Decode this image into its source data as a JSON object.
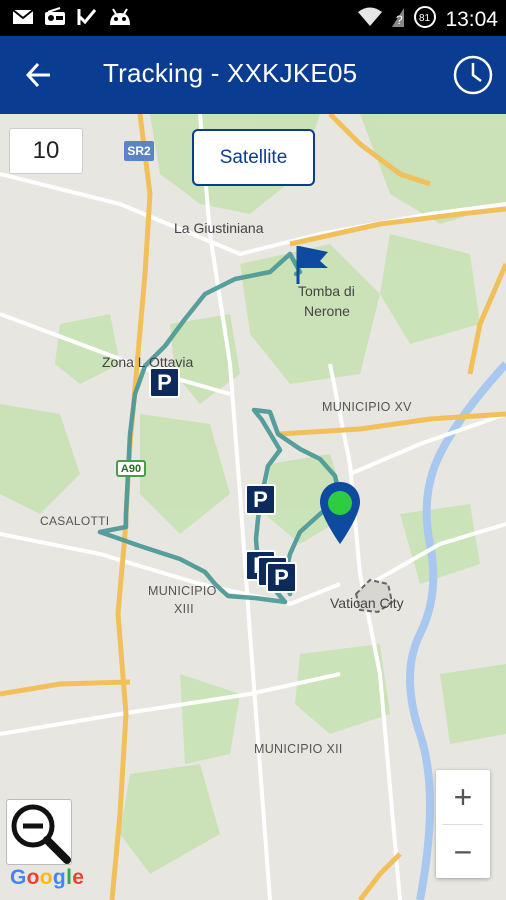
{
  "status_bar": {
    "time": "13:04",
    "icons": [
      "gmail-icon",
      "radio-icon",
      "check-flag-icon",
      "android-icon",
      "wifi-icon",
      "signal-icon",
      "battery-icon"
    ]
  },
  "app_bar": {
    "title": "Tracking - XXKJKE05",
    "back_icon": "arrow-back-icon",
    "history_icon": "clock-icon"
  },
  "map": {
    "count_value": "10",
    "satellite_label": "Satellite",
    "labels": {
      "sr2": "SR2",
      "la_giustiniana": "La Giustiniana",
      "tomba_di": "Tomba di",
      "nerone": "Nerone",
      "zona_ottavia": "Zona L Ottavia",
      "municipio_xv": "MUNICIPIO XV",
      "a90": "A90",
      "casalotti": "CASALOTTI",
      "municipio": "MUNICIPIO",
      "xiii": "XIII",
      "vatican_city": "Vatican City",
      "municipio_xii": "MUNICIPIO XII"
    },
    "parking_label": "P",
    "zoom_in": "+",
    "zoom_out": "−",
    "google": [
      "G",
      "o",
      "o",
      "g",
      "l",
      "e"
    ]
  },
  "colors": {
    "app_bar": "#0a3d91",
    "track": "#4f9b98",
    "pin": "#0d4aa0",
    "pin_dot": "#2ecc40",
    "parking": "#0d2a5c"
  }
}
